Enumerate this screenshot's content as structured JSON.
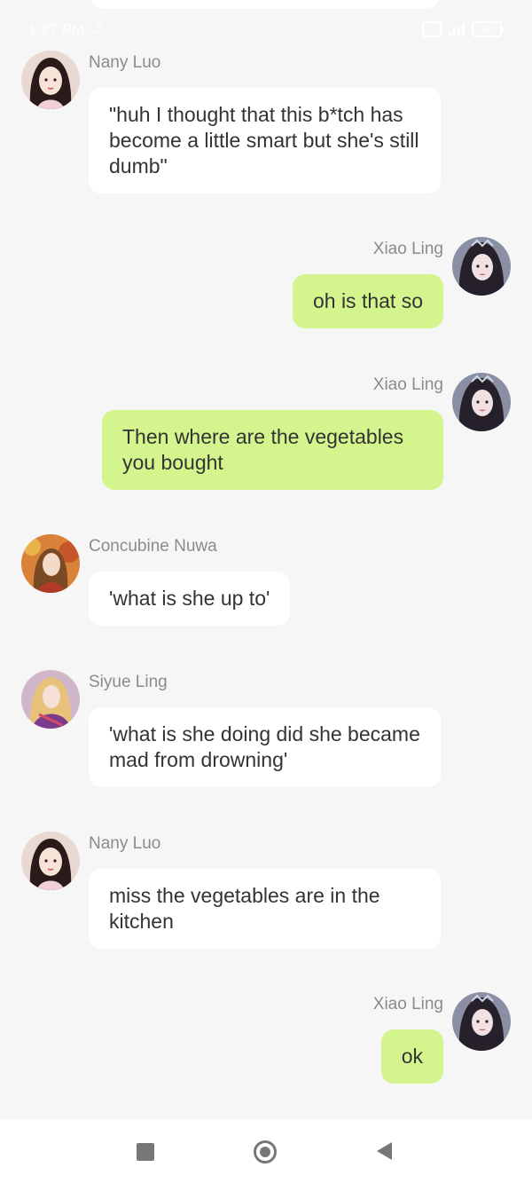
{
  "status_bar": {
    "time": "1:27 PM",
    "warning_glyph": "⚠",
    "battery_level": "58"
  },
  "messages": [
    {
      "side": "left",
      "sender": "Nany Luo",
      "text": "\"huh I thought that this b*tch has become a little smart but she's still dumb\""
    },
    {
      "side": "right",
      "sender": "Xiao Ling",
      "text": "oh is that so"
    },
    {
      "side": "right",
      "sender": "Xiao Ling",
      "text": "Then where are the vegetables you bought"
    },
    {
      "side": "left",
      "sender": "Concubine Nuwa",
      "text": "'what is she up to'"
    },
    {
      "side": "left",
      "sender": "Siyue Ling",
      "text": "'what is she doing did she became mad from drowning'"
    },
    {
      "side": "left",
      "sender": "Nany Luo",
      "text": "miss the vegetables are in the kitchen"
    },
    {
      "side": "right",
      "sender": "Xiao Ling",
      "text": "ok"
    }
  ],
  "colors": {
    "incoming_bubble": "#ffffff",
    "outgoing_bubble": "#d4f58e",
    "background": "#f6f6f6",
    "sender_name": "#8b8b8b"
  },
  "icons": {
    "nav_recents": "square-icon",
    "nav_home": "home-circle-icon",
    "nav_back": "back-triangle-icon"
  }
}
